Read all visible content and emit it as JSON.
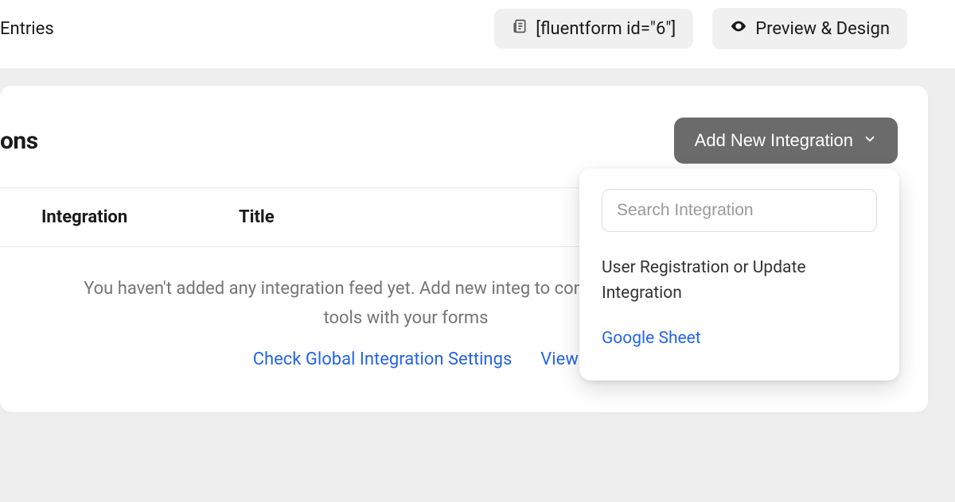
{
  "topbar": {
    "left_tab": "Entries",
    "shortcode_pill": "[fluentform id=\"6\"]",
    "preview_button": "Preview & Design"
  },
  "card": {
    "title_fragment": "ons",
    "add_button": "Add New Integration",
    "columns": {
      "integration": "Integration",
      "title": "Title"
    },
    "empty_message": "You haven't added any integration feed yet. Add new integ to connect your favourite tools with your forms",
    "links": {
      "global_settings": "Check Global Integration Settings",
      "documentation": "View Documentatio"
    }
  },
  "dropdown": {
    "search_placeholder": "Search Integration",
    "items": [
      {
        "label": "User Registration or Update Integration",
        "style": "dark"
      },
      {
        "label": "Google Sheet",
        "style": "link"
      }
    ]
  }
}
